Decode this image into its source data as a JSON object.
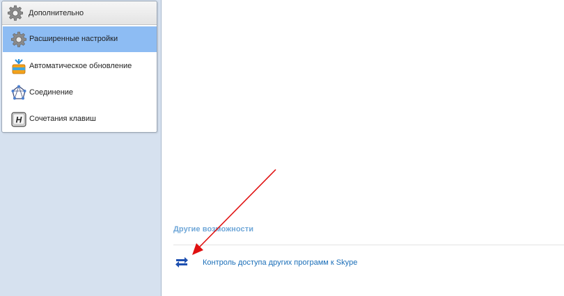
{
  "sidebar": {
    "header": {
      "title": "Дополнительно",
      "icon": "gear-icon"
    },
    "items": [
      {
        "label": "Расширенные настройки",
        "icon": "gear-icon",
        "selected": true
      },
      {
        "label": "Автоматическое обновление",
        "icon": "update-box-icon",
        "selected": false
      },
      {
        "label": "Соединение",
        "icon": "connection-icon",
        "selected": false
      },
      {
        "label": "Сочетания клавиш",
        "icon": "hotkey-h-icon",
        "selected": false
      }
    ]
  },
  "main": {
    "section_title": "Другие возможности",
    "links": [
      {
        "label": "Контроль доступа других программ к Skype",
        "icon": "transfer-arrows-icon"
      }
    ]
  },
  "annotation": {
    "color": "#e01010",
    "description": "red-arrow-pointer"
  },
  "colors": {
    "selected_bg": "#8dbcf3",
    "section_title": "#6fa7d8",
    "link": "#1a6eb8",
    "sidebar_bg": "#d6e1ef"
  }
}
